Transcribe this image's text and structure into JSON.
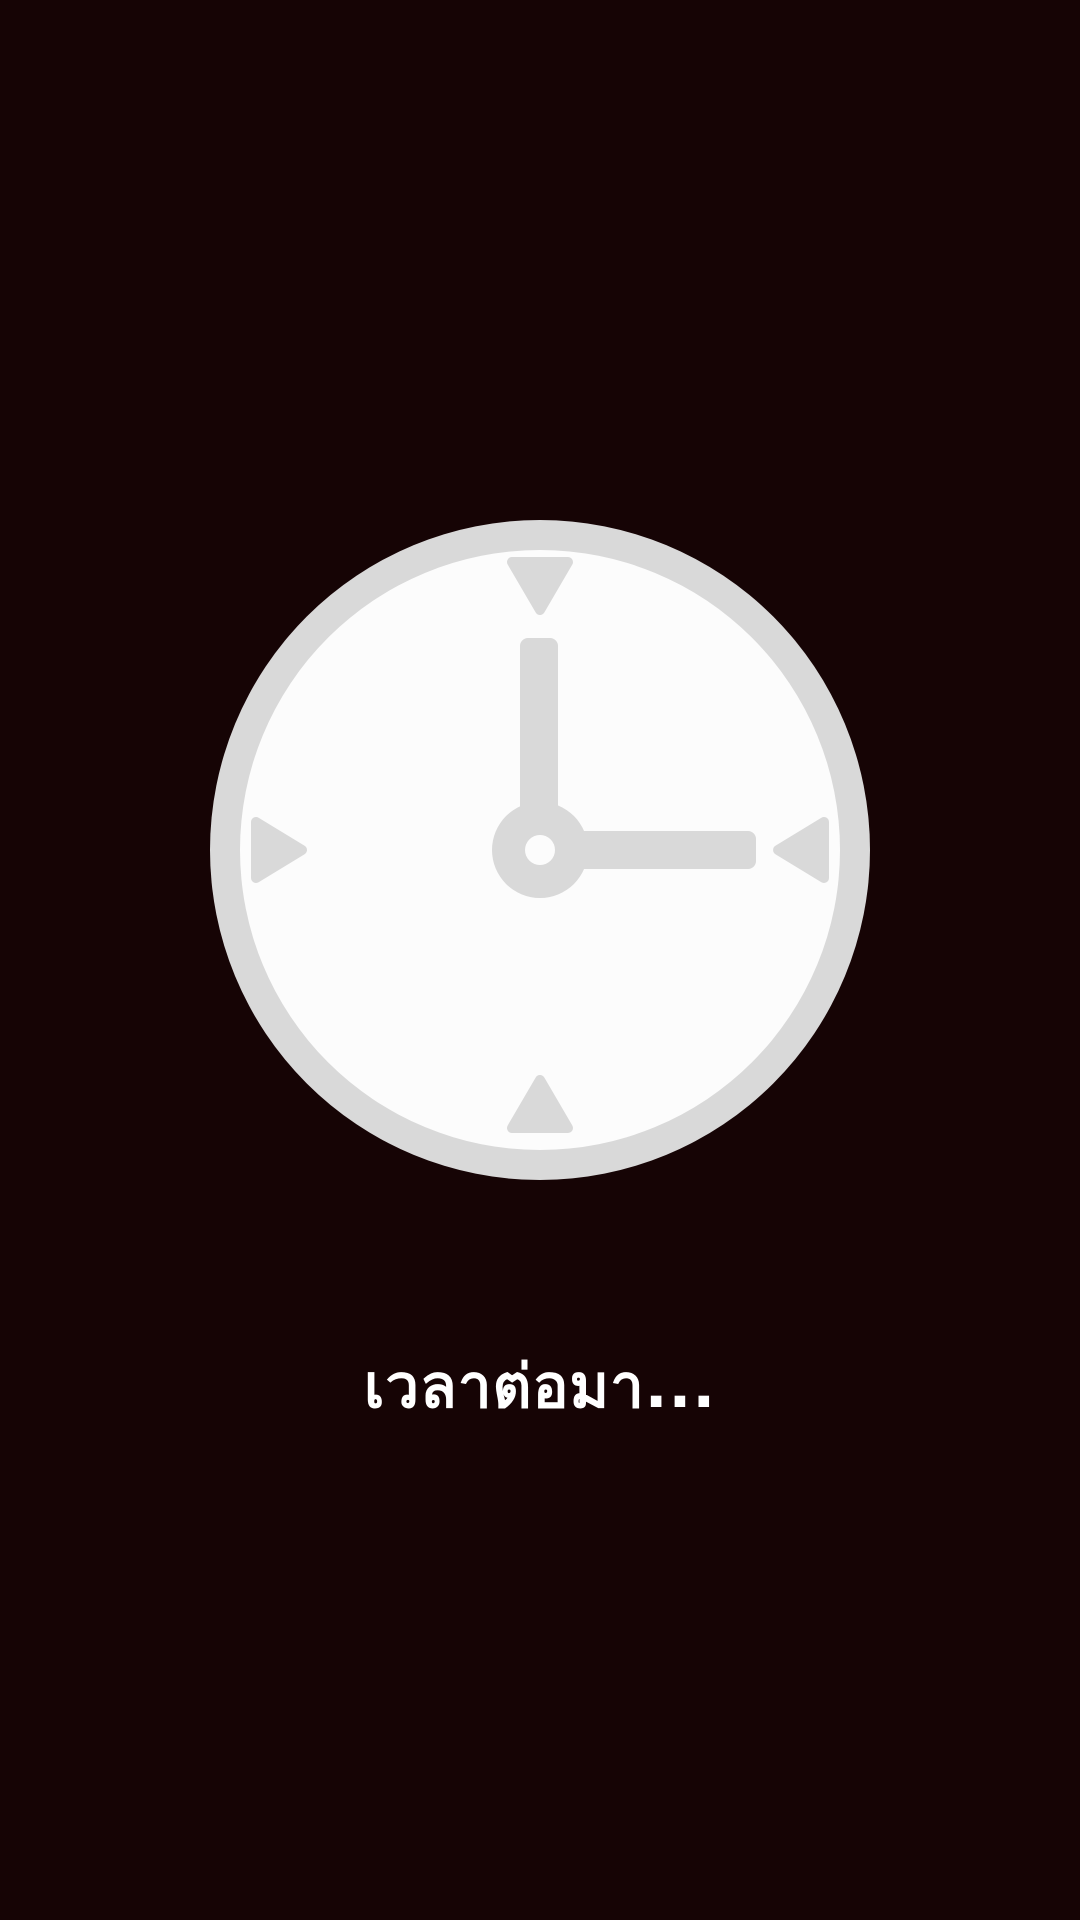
{
  "caption": "เวลาต่อมา...",
  "clock": {
    "hour": 3,
    "minute": 0,
    "icon": "clock-icon"
  },
  "colors": {
    "background": "#160405",
    "clock_face": "#fcfcfc",
    "clock_bezel": "#d9d9d9",
    "clock_hands": "#d9d9d9",
    "caption": "#ffffff"
  }
}
